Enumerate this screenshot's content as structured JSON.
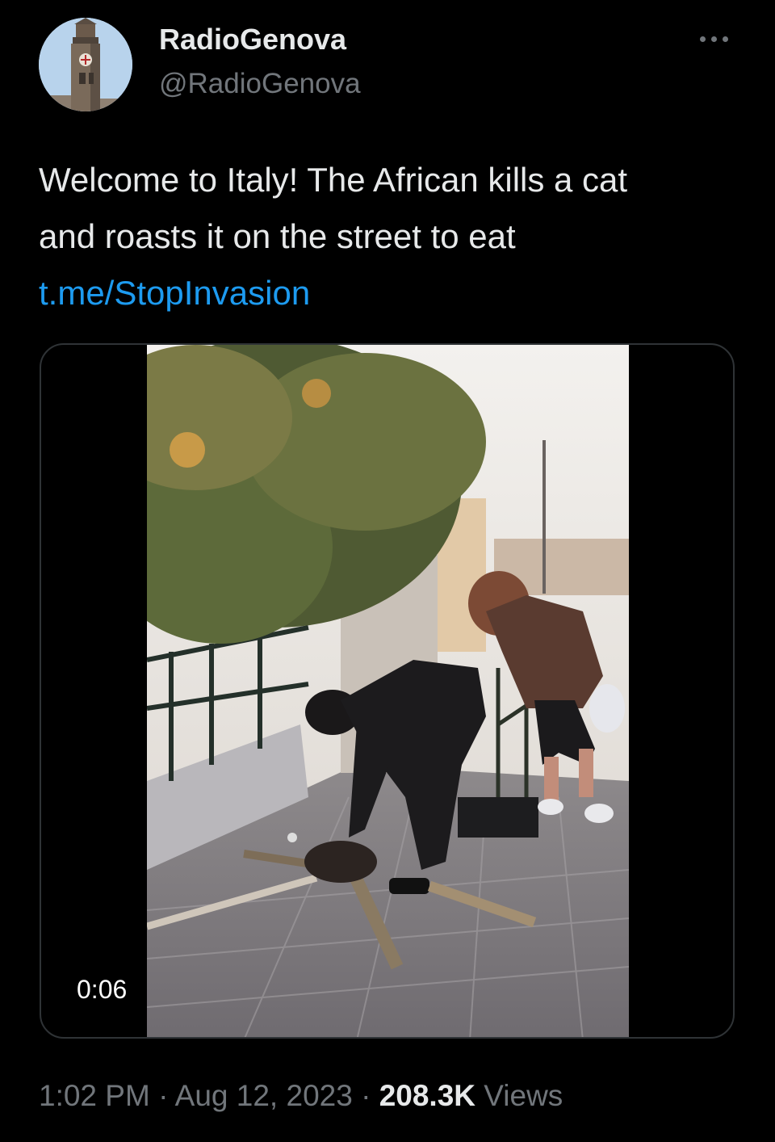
{
  "author": {
    "display_name": "RadioGenova",
    "handle": "@RadioGenova",
    "avatar_icon": "clock-tower-avatar"
  },
  "more_icon": "more-horizontal-icon",
  "tweet": {
    "text_line_1": "Welcome to Italy! The African kills a cat",
    "text_line_2": "and roasts it on the street to eat",
    "link": "t.me/StopInvasion"
  },
  "media": {
    "type": "video",
    "duration": "0:06"
  },
  "meta": {
    "time": "1:02 PM",
    "separator_1": "·",
    "date": "Aug 12, 2023",
    "separator_2": "·",
    "views_count": "208.3K",
    "views_label": "Views"
  },
  "colors": {
    "background": "#000000",
    "text_primary": "#e7e9ea",
    "text_secondary": "#71767b",
    "link": "#1d9bf0",
    "border": "#2f3336"
  }
}
